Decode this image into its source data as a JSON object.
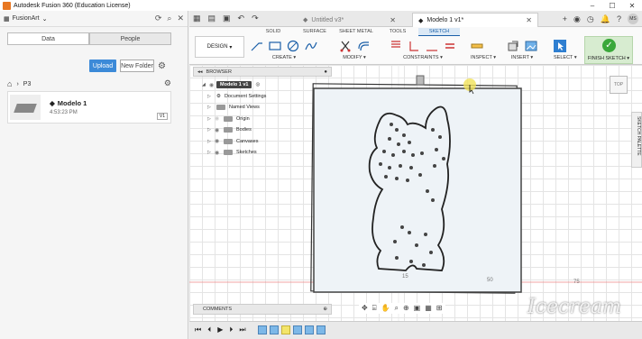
{
  "window": {
    "title": "Autodesk Fusion 360 (Education License)"
  },
  "data_panel": {
    "team": "FusionArt",
    "tabs": [
      "Data",
      "People"
    ],
    "upload": "Upload",
    "new_folder": "New Folder",
    "breadcrumb": "P3",
    "file": {
      "name": "Modelo 1",
      "time": "4:53:23 PM",
      "version": "V1"
    }
  },
  "doc_tabs": {
    "inactive": "Untitled v3*",
    "active": "Modelo 1 v1*"
  },
  "avatar": "MS",
  "ribbon": {
    "tabs": [
      "SOLID",
      "SURFACE",
      "SHEET METAL",
      "TOOLS",
      "SKETCH"
    ],
    "design": "DESIGN",
    "groups": [
      "CREATE",
      "MODIFY",
      "CONSTRAINTS",
      "INSPECT",
      "INSERT",
      "SELECT"
    ],
    "finish": "FINISH SKETCH"
  },
  "browser": {
    "title": "BROWSER",
    "root": "Modelo 1 v1",
    "items": [
      "Document Settings",
      "Named Views",
      "Origin",
      "Bodies",
      "Canvases",
      "Sketches"
    ]
  },
  "comments": "COMMENTS",
  "viewcube": "TOP",
  "sketch_palette": "SKETCH PALETTE",
  "dims": {
    "d1": "15",
    "d2": "50",
    "d3": "75"
  },
  "watermark": "Icecream"
}
